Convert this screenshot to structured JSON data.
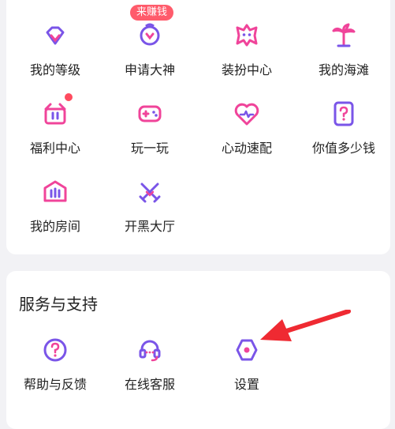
{
  "features": {
    "items": [
      {
        "label": "我的等级",
        "icon": "diamond-level-icon"
      },
      {
        "label": "申请大神",
        "icon": "god-apply-icon",
        "badge": "来赚钱"
      },
      {
        "label": "装扮中心",
        "icon": "star-dress-icon"
      },
      {
        "label": "我的海滩",
        "icon": "palm-tree-icon"
      },
      {
        "label": "福利中心",
        "icon": "gift-icon",
        "dot": true
      },
      {
        "label": "玩一玩",
        "icon": "gamepad-icon"
      },
      {
        "label": "心动速配",
        "icon": "heart-pulse-icon"
      },
      {
        "label": "你值多少钱",
        "icon": "question-card-icon"
      },
      {
        "label": "我的房间",
        "icon": "room-icon"
      },
      {
        "label": "开黑大厅",
        "icon": "crossed-swords-icon"
      }
    ]
  },
  "service": {
    "title": "服务与支持",
    "items": [
      {
        "label": "帮助与反馈",
        "icon": "help-icon"
      },
      {
        "label": "在线客服",
        "icon": "headset-icon"
      },
      {
        "label": "设置",
        "icon": "hexagon-settings-icon"
      }
    ]
  },
  "colors": {
    "purple": "#7a55e8",
    "pink": "#f0449a",
    "red": "#ff4b5f",
    "arrow": "#ef2a32"
  }
}
